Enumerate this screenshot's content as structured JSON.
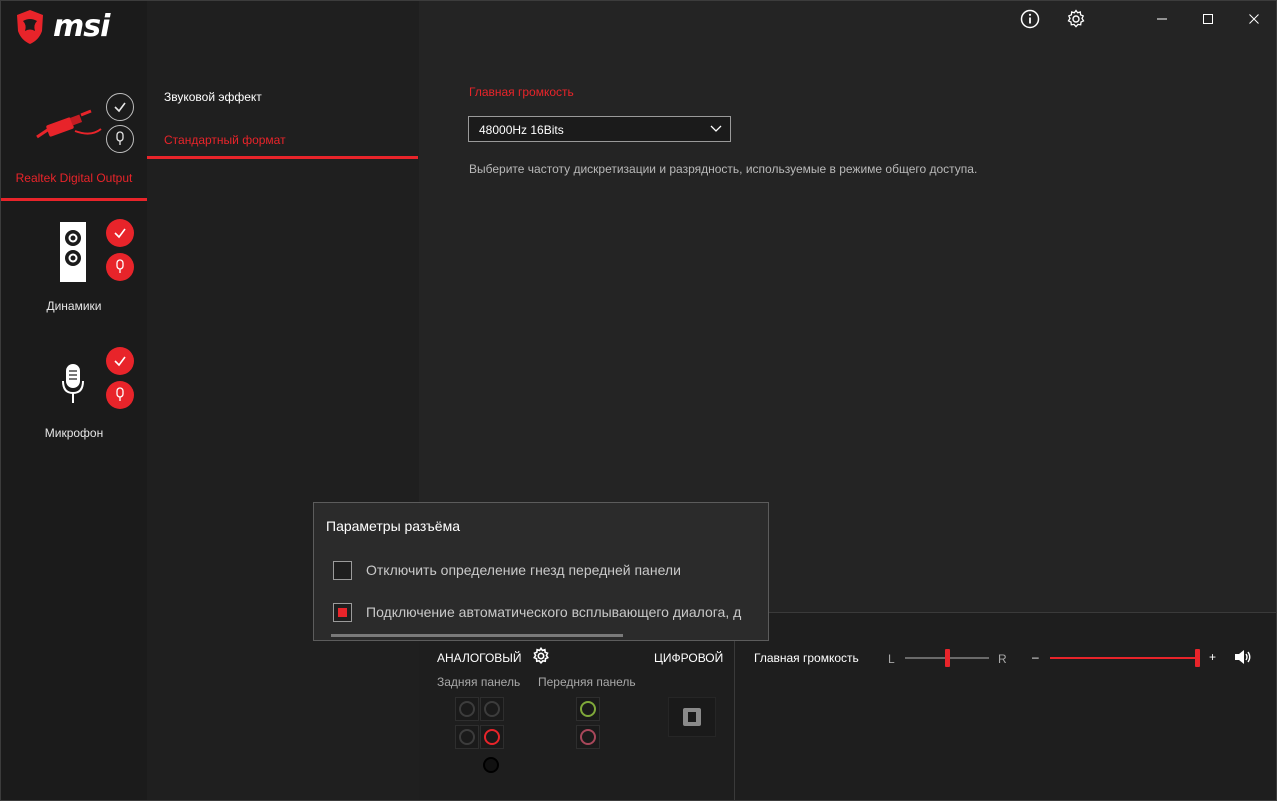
{
  "app": {
    "brand": "msi"
  },
  "window_controls": {
    "info_icon": "info-icon",
    "settings_icon": "gear-icon",
    "minimize_icon": "minimize-icon",
    "maximize_icon": "maximize-icon",
    "close_icon": "close-icon"
  },
  "devices": [
    {
      "label": "Realtek Digital Output",
      "active": true,
      "icon": "digital-cable-icon"
    },
    {
      "label": "Динамики",
      "active": false,
      "icon": "speaker-icon"
    },
    {
      "label": "Микрофон",
      "active": false,
      "icon": "microphone-icon"
    }
  ],
  "subnav": {
    "items": [
      {
        "label": "Звуковой эффект",
        "active": false
      },
      {
        "label": "Стандартный формат",
        "active": true
      }
    ]
  },
  "main": {
    "section_title": "Главная громкость",
    "format_select": {
      "value": "48000Hz 16Bits"
    },
    "description": "Выберите частоту дискретизации и разрядность, используемые в режиме общего доступа."
  },
  "bottom": {
    "analog_label": "АНАЛОГОВЫЙ",
    "digital_label": "ЦИФРОВОЙ",
    "rear_panel_label": "Задняя панель",
    "front_panel_label": "Передняя панель",
    "master_volume_label": "Главная громкость",
    "balance_left": "L",
    "balance_right": "R",
    "volume_minus": "–",
    "volume_plus": "+",
    "balance_value": 0.5,
    "volume_value": 1.0
  },
  "popup": {
    "title": "Параметры разъёма",
    "options": [
      {
        "label": "Отключить определение гнезд передней панели",
        "checked": false
      },
      {
        "label": "Подключение автоматического всплывающего диалога, д",
        "checked": true
      }
    ]
  },
  "colors": {
    "accent": "#e8242a",
    "background": "#242424",
    "rail": "#1b1b1b",
    "jack_green": "#9bd13a",
    "jack_pink": "#d9687e"
  }
}
